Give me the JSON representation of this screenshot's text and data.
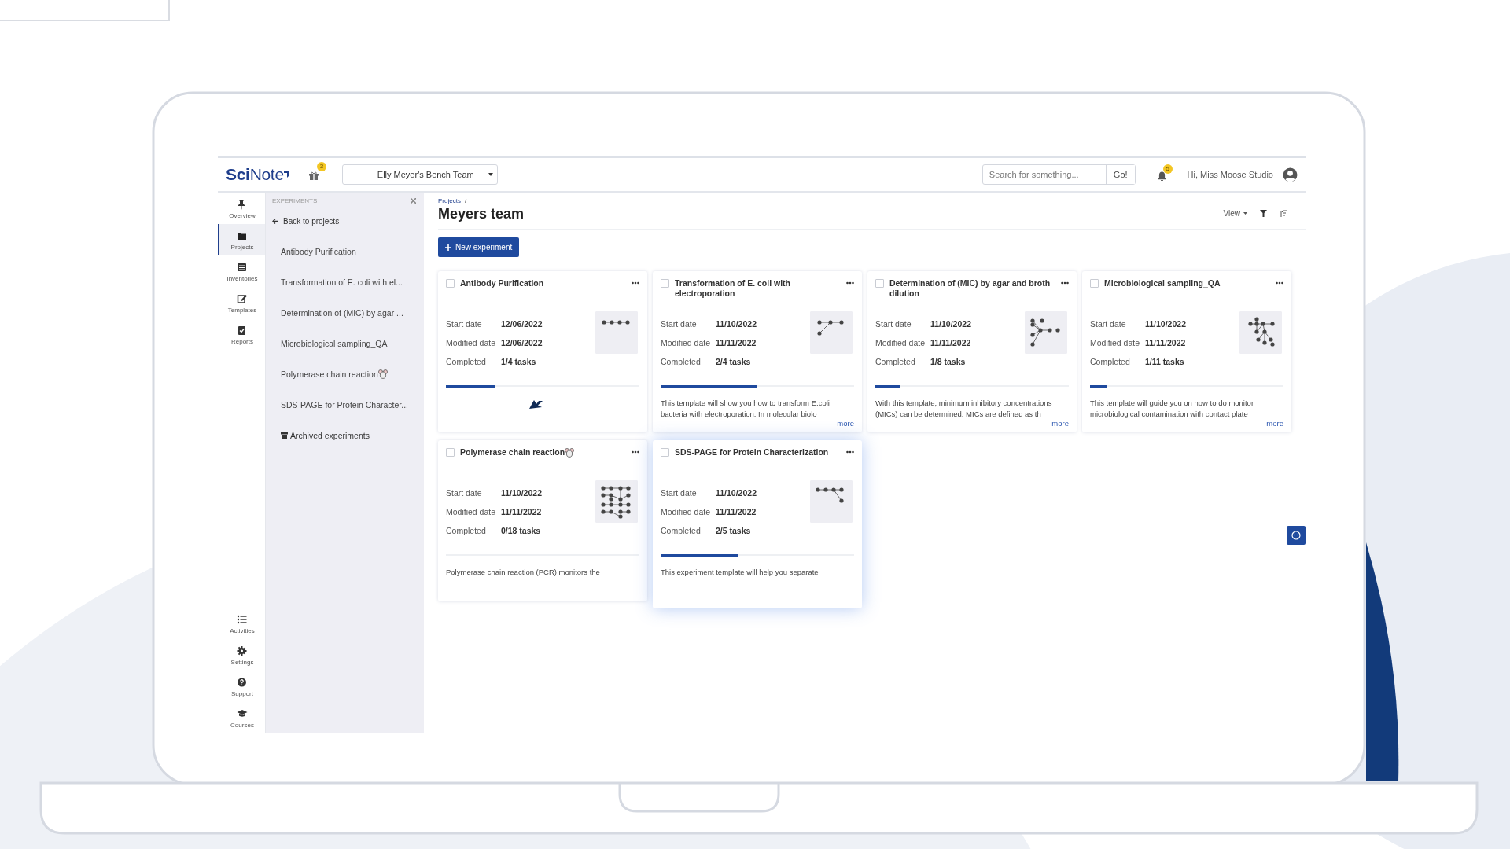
{
  "header": {
    "logo_bold": "Sci",
    "logo_rest": "Note",
    "gift_count": "3",
    "team": "Elly Meyer's Bench Team",
    "search": {
      "placeholder": "Search for something..."
    },
    "search_button": "Go!",
    "notification_count": "5",
    "greeting": "Hi, Miss Moose Studio"
  },
  "nav": {
    "top": [
      {
        "label": "Overview",
        "selected": false
      },
      {
        "label": "Projects",
        "selected": true
      },
      {
        "label": "Inventories",
        "selected": false
      },
      {
        "label": "Templates",
        "selected": false
      },
      {
        "label": "Reports",
        "selected": false
      }
    ],
    "bottom": [
      {
        "label": "Activities",
        "selected": false
      },
      {
        "label": "Settings",
        "selected": false
      },
      {
        "label": "Support",
        "selected": false
      },
      {
        "label": "Courses",
        "selected": false
      }
    ]
  },
  "experiments_panel": {
    "heading": "EXPERIMENTS",
    "back": "Back to projects",
    "items": [
      {
        "label": "Antibody Purification",
        "badge": false
      },
      {
        "label": "Transformation of E. coli with el...",
        "badge": false
      },
      {
        "label": "Determination of (MIC) by agar ...",
        "badge": false
      },
      {
        "label": "Microbiological sampling_QA",
        "badge": false
      },
      {
        "label": "Polymerase chain reaction",
        "badge": true
      },
      {
        "label": "SDS-PAGE for Protein Character...",
        "badge": false
      }
    ],
    "archived": "Archived experiments"
  },
  "breadcrumb": {
    "link": "Projects",
    "separator": "/"
  },
  "title": "Meyers team",
  "toolbar": {
    "view": "View"
  },
  "new_button": "New experiment",
  "cards": [
    {
      "title": "Antibody Purification",
      "badge": false,
      "checked": false,
      "highlighted": false,
      "fields": [
        {
          "label": "Start date",
          "value": "12/06/2022"
        },
        {
          "label": "Modified date",
          "value": "12/06/2022"
        },
        {
          "label": "Completed",
          "value": "1/4 tasks"
        }
      ],
      "level": 0.25
    },
    {
      "title": "Transformation of E. coli with electroporation",
      "badge": false,
      "checked": false,
      "highlighted": false,
      "fields": [
        {
          "label": "Start date",
          "value": "11/10/2022"
        },
        {
          "label": "Modified date",
          "value": "11/11/2022"
        },
        {
          "label": "Completed",
          "value": "2/4 tasks"
        }
      ],
      "level": 0.5,
      "description_lines": [
        "This template will show you how to transform E.coli",
        "bacteria with electroporation. In molecular biolo"
      ],
      "more": "more"
    },
    {
      "title": "Determination of (MIC) by agar and broth dilution",
      "badge": false,
      "checked": false,
      "highlighted": false,
      "fields": [
        {
          "label": "Start date",
          "value": "11/10/2022"
        },
        {
          "label": "Modified date",
          "value": "11/11/2022"
        },
        {
          "label": "Completed",
          "value": "1/8 tasks"
        }
      ],
      "level": 0.125,
      "description_lines": [
        "With this template, minimum inhibitory concentrations",
        "(MICs) can be determined. MICs are defined as th"
      ],
      "more": "more"
    },
    {
      "title": "Microbiological sampling_QA",
      "badge": false,
      "checked": false,
      "highlighted": false,
      "fields": [
        {
          "label": "Start date",
          "value": "11/10/2022"
        },
        {
          "label": "Modified date",
          "value": "11/11/2022"
        },
        {
          "label": "Completed",
          "value": "1/11 tasks"
        }
      ],
      "level": 0.09,
      "description_lines": [
        "This template will guide you on how to do monitor",
        "microbiological contamination with contact plate"
      ],
      "more": "more"
    },
    {
      "title": "Polymerase chain reaction",
      "badge": true,
      "checked": false,
      "highlighted": false,
      "fields": [
        {
          "label": "Start date",
          "value": "11/10/2022"
        },
        {
          "label": "Modified date",
          "value": "11/11/2022"
        },
        {
          "label": "Completed",
          "value": "0/18 tasks"
        }
      ],
      "level": 0,
      "description_lines": [
        "Polymerase chain reaction (PCR) monitors the"
      ]
    },
    {
      "title": "SDS-PAGE for Protein Characterization",
      "badge": false,
      "checked": false,
      "highlighted": true,
      "fields": [
        {
          "label": "Start date",
          "value": "11/10/2022"
        },
        {
          "label": "Modified date",
          "value": "11/11/2022"
        },
        {
          "label": "Completed",
          "value": "2/5 tasks"
        }
      ],
      "level": 0.4,
      "description_lines": [
        "This experiment template will help you separate"
      ]
    }
  ]
}
